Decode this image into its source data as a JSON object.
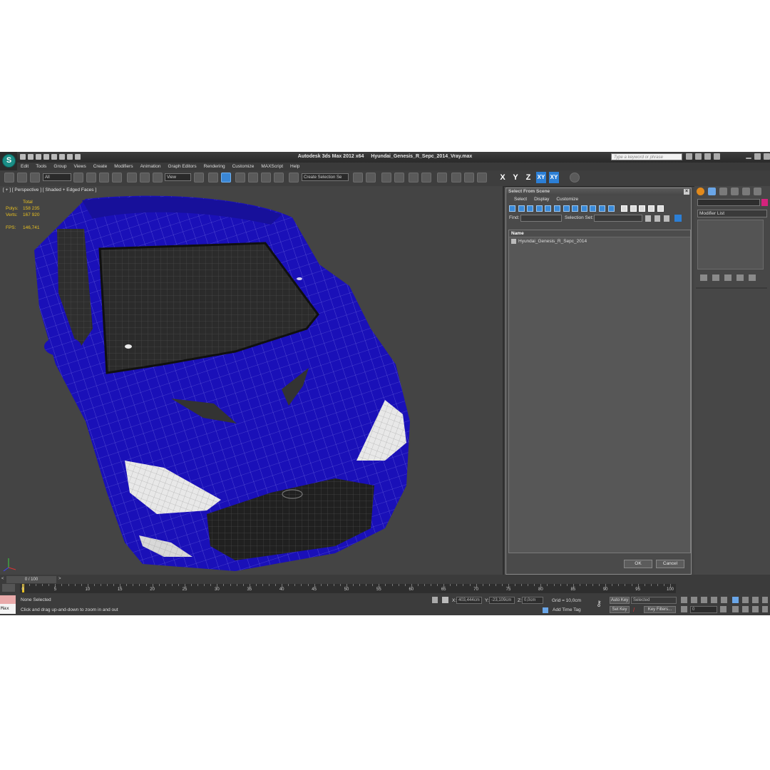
{
  "app": {
    "title": "Autodesk 3ds Max  2012 x64",
    "file": "Hyundai_Genesis_R_Sepc_2014_Vray.max",
    "search_placeholder": "Type a keyword or phrase",
    "logo_letter": "S"
  },
  "menu": [
    "Edit",
    "Tools",
    "Group",
    "Views",
    "Create",
    "Modifiers",
    "Animation",
    "Graph Editors",
    "Rendering",
    "Customize",
    "MAXScript",
    "Help"
  ],
  "toolbar": {
    "filter": "All",
    "ref_coord": "View",
    "selection_set": "Create Selection Se",
    "axes": [
      "X",
      "Y",
      "Z",
      "XY",
      "XY"
    ]
  },
  "viewport": {
    "label": "[ + ] [ Perspective ] [ Shaded + Edged Faces ]",
    "stats": {
      "total_label": "Total",
      "polys_label": "Polys:",
      "polys": "158 235",
      "verts_label": "Verts:",
      "verts": "167 920",
      "fps_label": "FPS:",
      "fps": "146,741"
    },
    "car_color": "#1a10b8"
  },
  "dialog": {
    "title": "Select From Scene",
    "menu": [
      "Select",
      "Display",
      "Customize"
    ],
    "find_label": "Find:",
    "selection_set_label": "Selection Set:",
    "column_name": "Name",
    "objects": [
      "Hyundai_Genesis_R_Sepc_2014"
    ],
    "ok": "OK",
    "cancel": "Cancel"
  },
  "command_panel": {
    "modifier_list": "Modifier List",
    "object_color": "#d4237d"
  },
  "timeline": {
    "frame": "0 / 100",
    "ticks": [
      "0",
      "5",
      "10",
      "15",
      "20",
      "25",
      "30",
      "35",
      "40",
      "45",
      "50",
      "55",
      "60",
      "65",
      "70",
      "75",
      "80",
      "85",
      "90",
      "95",
      "100"
    ]
  },
  "status": {
    "listener": "Max",
    "selection": "None Selected",
    "prompt": "Click and drag up-and-down to zoom in and out",
    "x_label": "X:",
    "x": "403,444cm",
    "y_label": "Y:",
    "y": "-23,109cm",
    "z_label": "Z:",
    "z": "0,0cm",
    "grid": "Grid = 10,0cm",
    "add_time_tag": "Add Time Tag",
    "auto_key": "Auto Key",
    "selected": "Selected",
    "set_key": "Set Key",
    "key_filters": "Key Filters...",
    "frame_field": "0"
  }
}
